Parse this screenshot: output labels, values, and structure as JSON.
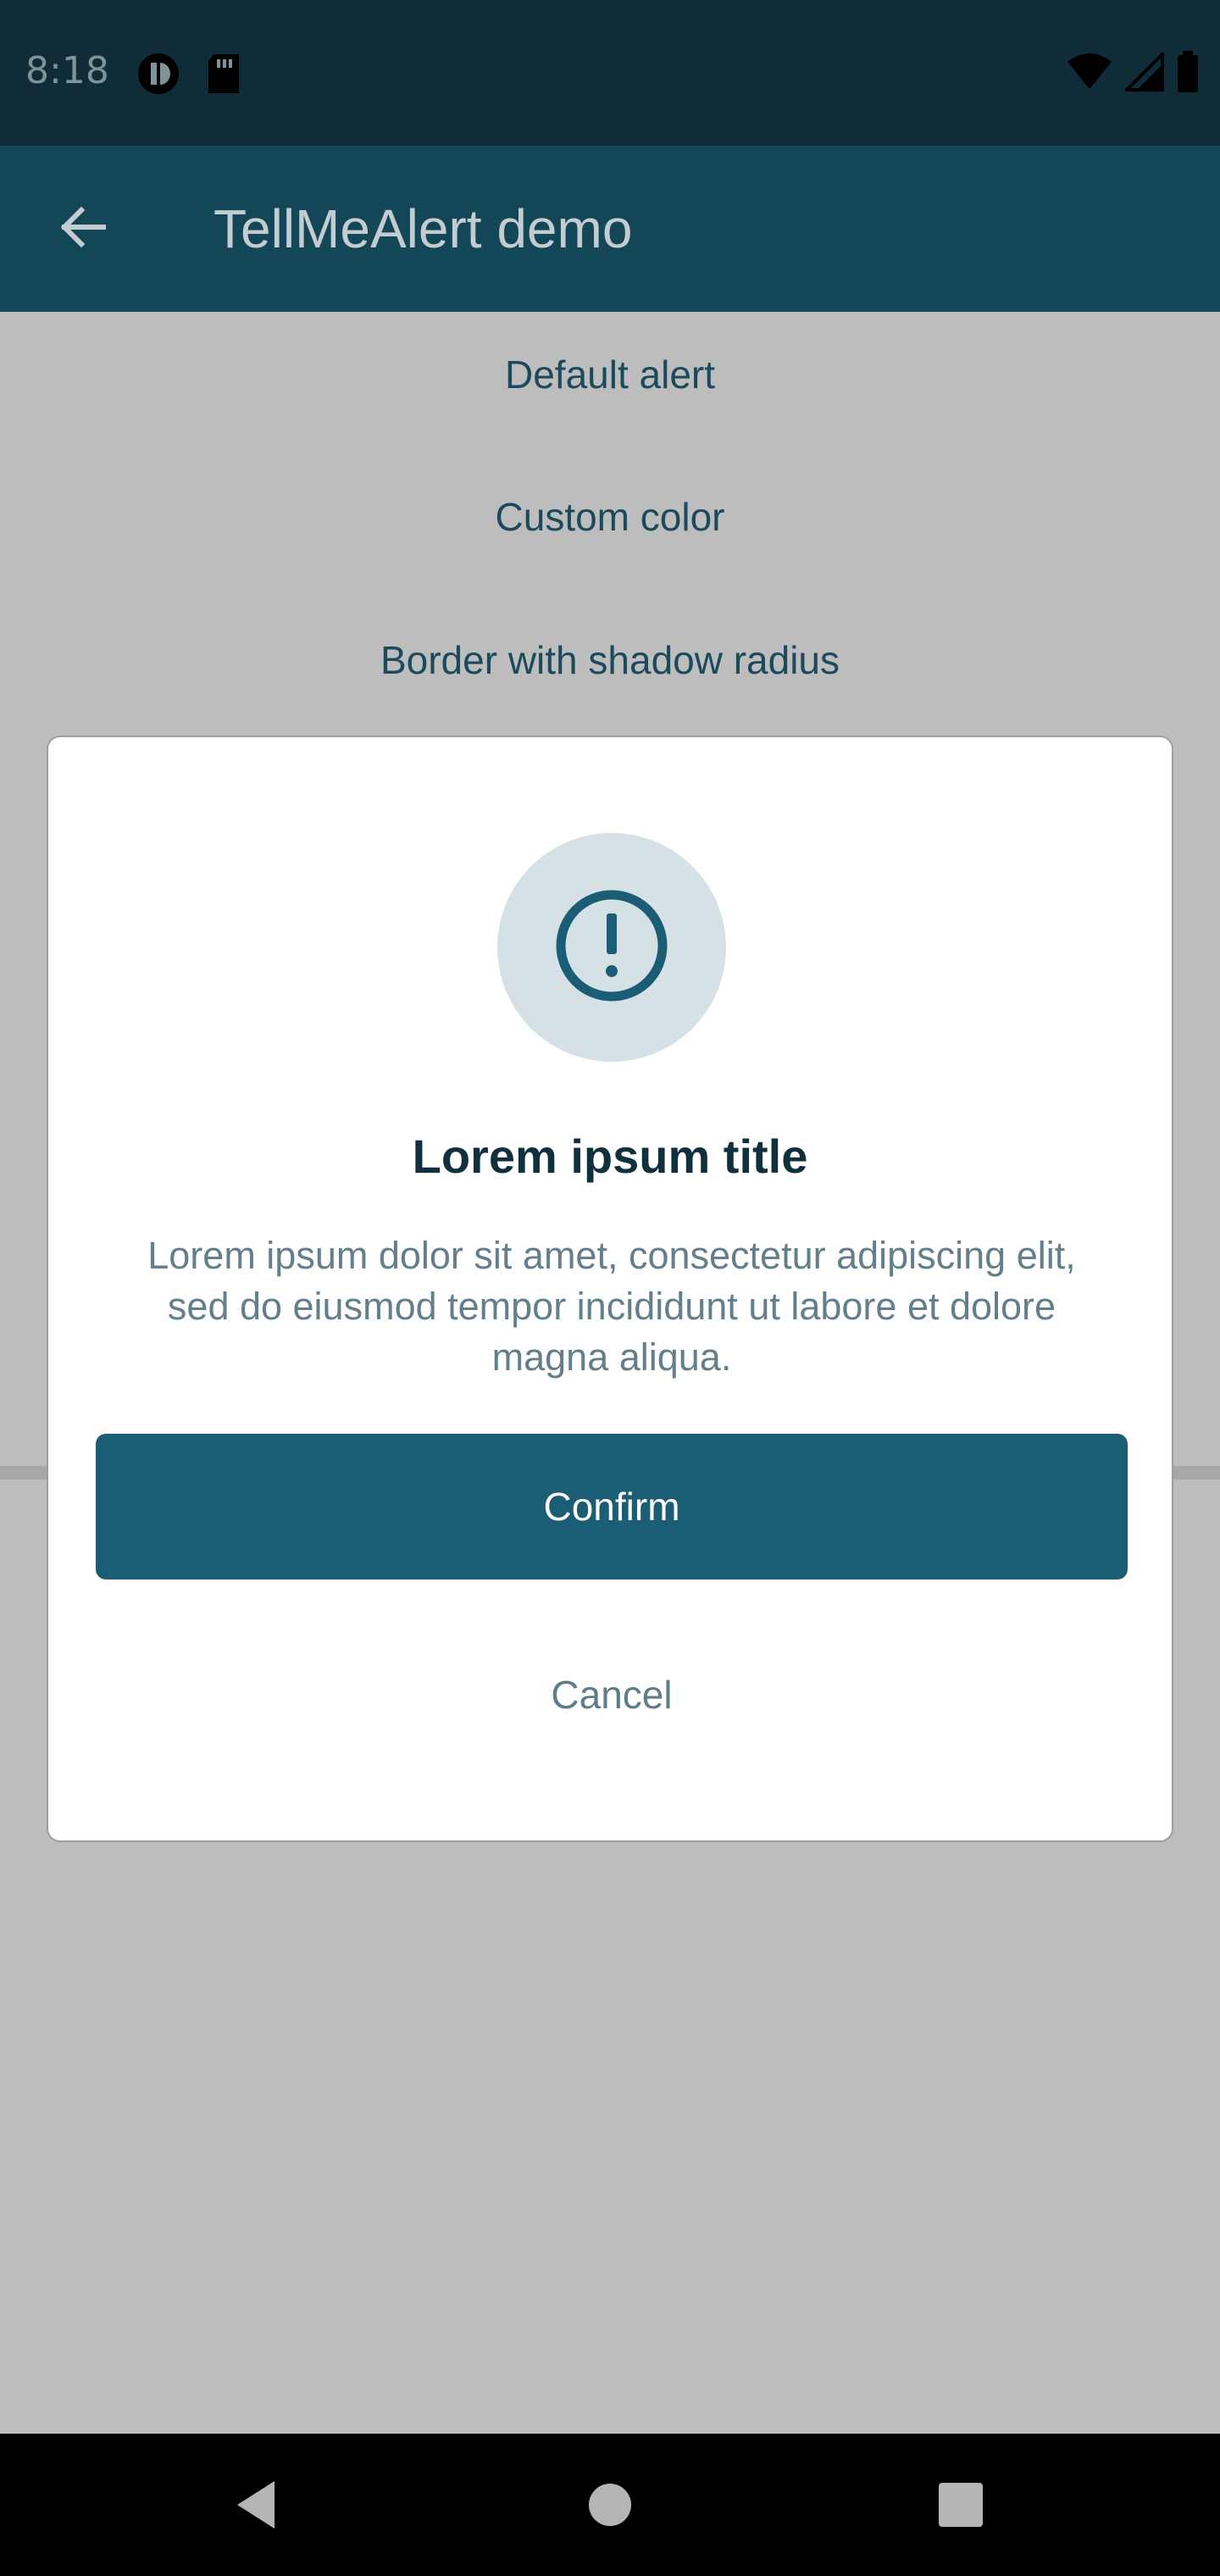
{
  "status_bar": {
    "time": "8:18",
    "icons": [
      "notification-app-icon",
      "sd-card-icon",
      "wifi-icon",
      "cell-signal-icon",
      "battery-icon"
    ]
  },
  "app_bar": {
    "title": "TellMeAlert demo",
    "back_icon": "arrow-back-icon"
  },
  "menu": {
    "items": [
      {
        "label": "Default alert"
      },
      {
        "label": "Custom color"
      },
      {
        "label": "Border with shadow radius"
      }
    ]
  },
  "dialog": {
    "icon": "exclamation-circle-icon",
    "title": "Lorem ipsum title",
    "body": "Lorem ipsum dolor sit amet, consectetur adipiscing elit, sed do eiusmod tempor incididunt ut labore et dolore magna aliqua.",
    "confirm_label": "Confirm",
    "cancel_label": "Cancel"
  },
  "colors": {
    "status_bar": "#0f2c38",
    "app_bar": "#134656",
    "scrim_background": "#bdbdbd",
    "accent": "#1a5d74",
    "icon_circle": "#d6e1e6"
  },
  "nav_bar": {
    "icons": [
      "nav-back-icon",
      "nav-home-icon",
      "nav-recents-icon"
    ]
  }
}
